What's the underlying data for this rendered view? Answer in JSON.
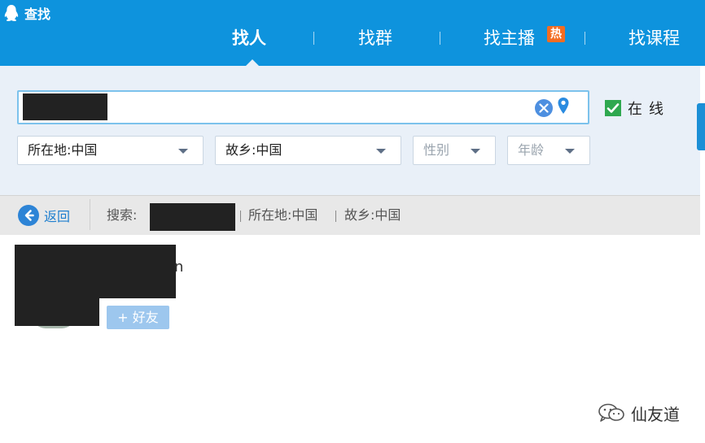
{
  "window": {
    "title": "查找"
  },
  "nav": {
    "tabs": [
      {
        "label": "找人",
        "active": true
      },
      {
        "label": "找群",
        "active": false
      },
      {
        "label": "找主播",
        "active": false,
        "badge": "热"
      },
      {
        "label": "找课程",
        "active": false
      }
    ]
  },
  "search": {
    "online_label": "在线",
    "online_checked": true,
    "filters": {
      "location": "所在地:中国",
      "hometown": "故乡:中国",
      "gender_placeholder": "性别",
      "age_placeholder": "年龄"
    }
  },
  "breadcrumb": {
    "back_label": "返回",
    "search_prefix": "搜索:",
    "location": "所在地:中国",
    "hometown": "故乡:中国"
  },
  "result": {
    "name_visible_part": "n",
    "add_friend_label": "+ 好友"
  },
  "watermark": {
    "text": "仙友道"
  },
  "colors": {
    "header_bg": "#0e93dd",
    "panel_bg": "#e9f0f8",
    "hot_badge": "#f36c21",
    "checkbox_green": "#2fa84f",
    "link_blue": "#1f7fcf",
    "add_button": "#9dc7ee"
  },
  "icons": {
    "app": "qq-penguin-icon",
    "clear": "clear-circle-icon",
    "location": "location-pin-icon",
    "back": "back-arrow-icon",
    "watermark": "wechat-icon"
  }
}
